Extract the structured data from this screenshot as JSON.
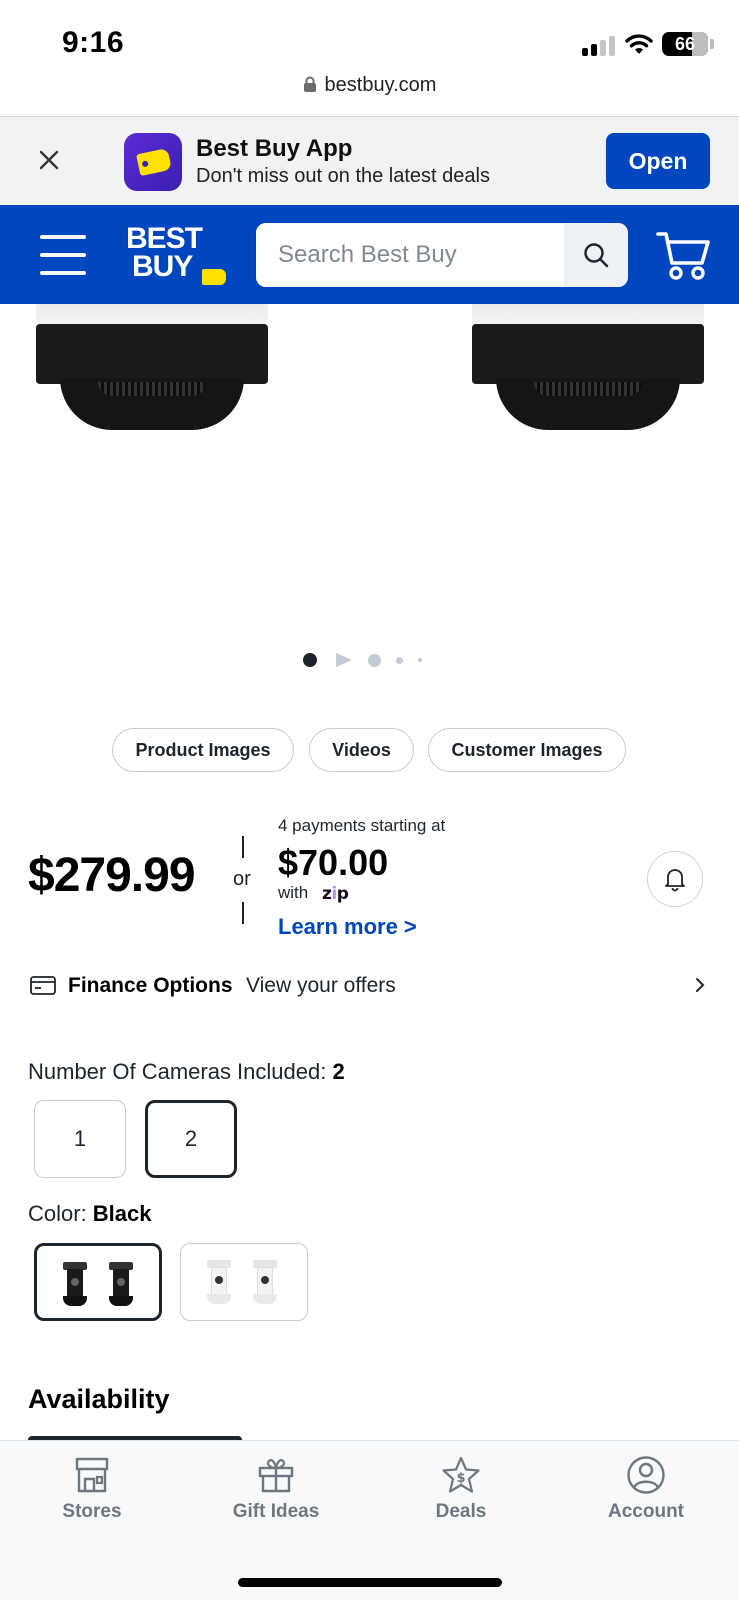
{
  "status_bar": {
    "time": "9:16",
    "battery_percent": "66",
    "signal_bars_filled": 2,
    "signal_bars_total": 4
  },
  "browser": {
    "url": "bestbuy.com"
  },
  "app_banner": {
    "title": "Best Buy App",
    "subtitle": "Don't miss out on the latest deals",
    "open_label": "Open"
  },
  "header": {
    "logo_line1": "BEST",
    "logo_line2": "BUY",
    "search_placeholder": "Search Best Buy"
  },
  "gallery": {
    "dot_count": 5,
    "active_dot": 0,
    "tabs": [
      "Product Images",
      "Videos",
      "Customer Images"
    ]
  },
  "pricing": {
    "price": "$279.99",
    "or": "or",
    "installment_lead": "4 payments starting at",
    "installment_amount": "$70.00",
    "with": "with",
    "provider_logo_text": "zip",
    "learn_more": "Learn more >"
  },
  "finance": {
    "title": "Finance Options",
    "subtitle": "View your offers"
  },
  "variants": {
    "cameras_label": "Number Of Cameras Included: ",
    "cameras_selected": "2",
    "camera_options": [
      "1",
      "2"
    ],
    "color_label": "Color: ",
    "color_selected": "Black"
  },
  "availability": {
    "heading": "Availability"
  },
  "bottom_nav": {
    "items": [
      {
        "label": "Stores",
        "icon": "store-icon"
      },
      {
        "label": "Gift Ideas",
        "icon": "gift-icon"
      },
      {
        "label": "Deals",
        "icon": "deals-star-icon"
      },
      {
        "label": "Account",
        "icon": "account-icon"
      }
    ]
  },
  "colors": {
    "brand_blue": "#0046be",
    "brand_yellow": "#ffe000",
    "text_dark": "#1d252c",
    "nav_gray": "#6f7680"
  }
}
